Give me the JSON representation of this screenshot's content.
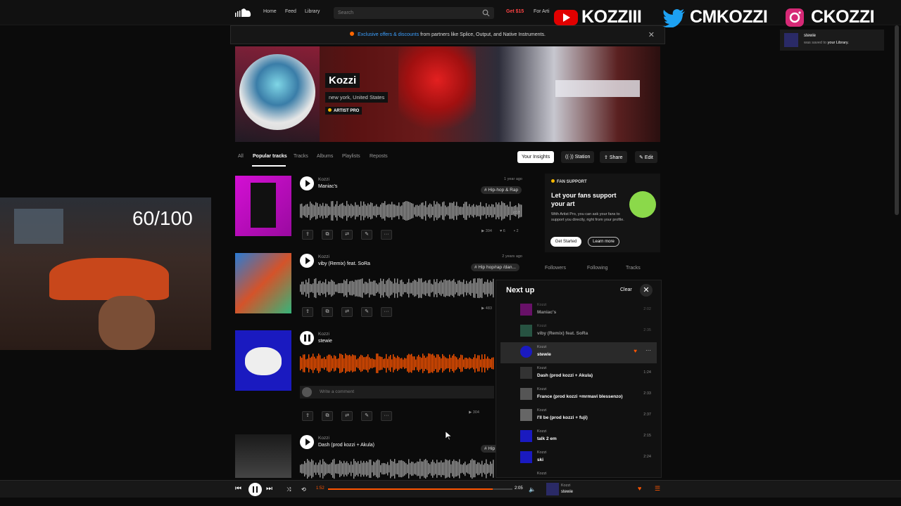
{
  "nav": {
    "links": [
      "Home",
      "Feed",
      "Library"
    ],
    "search_placeholder": "Search",
    "get15": "Get $15",
    "for_artists": "For Arti"
  },
  "promo": {
    "highlight": "Exclusive offers & discounts",
    "text": " from partners like Splice, Output, and Native Instruments.",
    "close": "✕"
  },
  "profile": {
    "name": "Kozzi",
    "location": "new york, United States",
    "badge": "ARTIST PRO"
  },
  "tabs": [
    "All",
    "Popular tracks",
    "Tracks",
    "Albums",
    "Playlists",
    "Reposts"
  ],
  "actions": [
    "Your Insights",
    "Station",
    "Share",
    "Edit"
  ],
  "tracks": [
    {
      "artist": "Kozzi",
      "title": "Maniac's",
      "age": "1 year ago",
      "tag": "# Hip-hop & Rap",
      "plays": "▶ 394",
      "likes": "♥ 6",
      "comments": "▪ 2",
      "time_on_wave": "2:02"
    },
    {
      "artist": "Kozzi",
      "title": "viby (Remix) feat. SoRa",
      "age": "2 years ago",
      "tag": "# Hip hop/rap /dan...",
      "plays": "▶ 483"
    },
    {
      "artist": "Kozzi",
      "title": "stewie",
      "plays": "▶ 304",
      "comment_placeholder": "Write a comment"
    },
    {
      "artist": "Kozzi",
      "title": "Dash (prod kozzi + Akula)",
      "tag": "# Hip"
    }
  ],
  "fan_support": {
    "label": "FAN SUPPORT",
    "heading": "Let your fans support your art",
    "body": "With Artist Pro, you can ask your fans to support you directly, right from your profile.",
    "get_started": "Get Started",
    "learn_more": "Learn more"
  },
  "stats_heads": [
    "Followers",
    "Following",
    "Tracks"
  ],
  "next_up": {
    "title": "Next up",
    "clear": "Clear",
    "close": "✕",
    "items": [
      {
        "artist": "Kozzi",
        "title": "Maniac's",
        "dur": "2:02"
      },
      {
        "artist": "Kozzi",
        "title": "viby (Remix) feat. SoRa",
        "dur": "2:35"
      },
      {
        "artist": "Kozzi",
        "title": "stewie",
        "dur": ""
      },
      {
        "artist": "Kozzi",
        "title": "Dash (prod kozzi + Akula)",
        "dur": "1:24"
      },
      {
        "artist": "Kozzi",
        "title": "France (prod kozzi +mrmavi blessenzo)",
        "dur": "2:33"
      },
      {
        "artist": "Kozzi",
        "title": "I'll be (prod kozzi + fuji)",
        "dur": "2:37"
      },
      {
        "artist": "Kozzi",
        "title": "talk 2 em",
        "dur": "2:15"
      },
      {
        "artist": "Kozzi",
        "title": "ski",
        "dur": "2:24"
      },
      {
        "artist": "Kozzi",
        "title": "",
        "dur": ""
      }
    ]
  },
  "toast": {
    "name": "stewie",
    "text_pre": "was saved to ",
    "text_link": "your Library."
  },
  "overlay": {
    "youtube": "KOZZIII",
    "twitter": "CMKOZZI",
    "instagram": "CKOZZI",
    "counter": "60/100"
  },
  "player": {
    "elapsed": "1:52",
    "total": "2:05",
    "progress": 0.893,
    "artist": "Kozzi",
    "title": "stewie"
  },
  "colors": {
    "accent": "#ff5500",
    "brand_bg": "#111111"
  }
}
